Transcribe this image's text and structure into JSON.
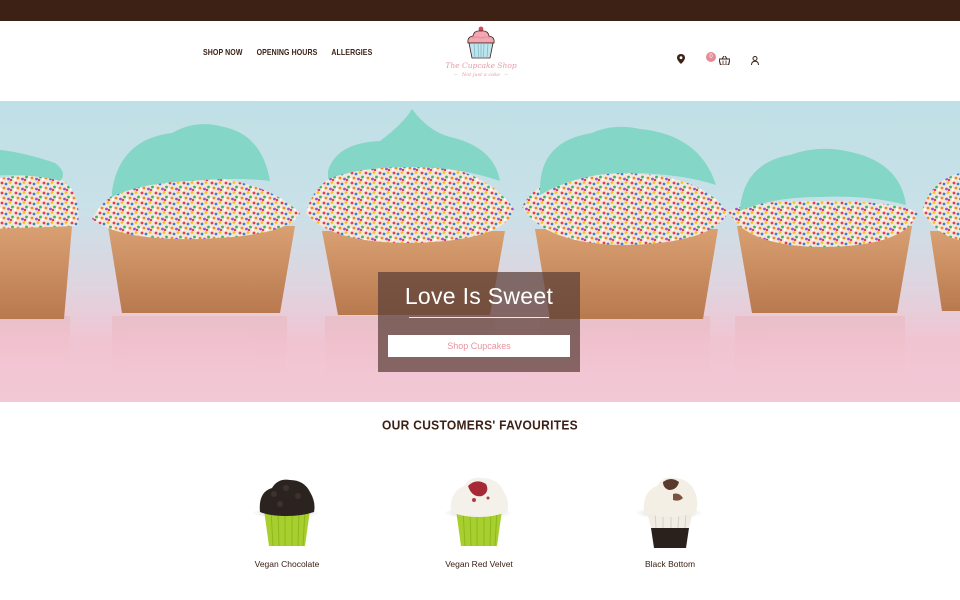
{
  "nav": {
    "items": [
      {
        "label": "SHOP NOW"
      },
      {
        "label": "OPENING HOURS"
      },
      {
        "label": "ALLERGIES"
      }
    ]
  },
  "logo": {
    "name": "The Cupcake Shop",
    "tagline": "Not just a cake"
  },
  "header_icons": {
    "location": "map-pin-icon",
    "cart": "basket-icon",
    "account": "user-icon",
    "cart_count": "0"
  },
  "hero": {
    "title": "Love Is Sweet",
    "button_label": "Shop Cupcakes"
  },
  "favourites": {
    "title": "OUR CUSTOMERS' FAVOURITES",
    "products": [
      {
        "name": "Vegan Chocolate"
      },
      {
        "name": "Vegan Red Velvet"
      },
      {
        "name": "Black Bottom"
      }
    ]
  },
  "colors": {
    "topbar": "#3e2115",
    "text_dark": "#3b2016",
    "accent_pink": "#e58c97",
    "frosting_mint": "#7fd8c6",
    "hero_overlay": "#5a3e38"
  }
}
